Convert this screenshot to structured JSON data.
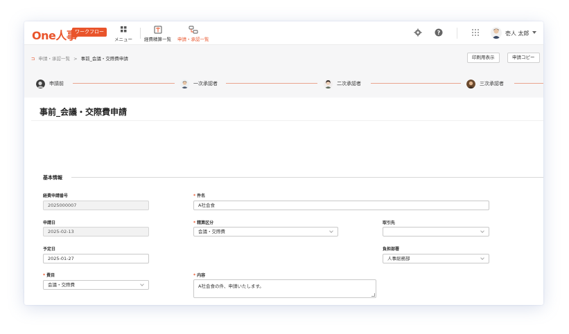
{
  "app": {
    "logo": "One人事",
    "logo_tag": "ワークフロー"
  },
  "nav": [
    {
      "label": "メニュー",
      "icon": "grid-menu-icon"
    },
    {
      "label": "経費精算一覧",
      "icon": "expense-list-icon"
    },
    {
      "label": "申請・承認一覧",
      "icon": "approval-list-icon",
      "active": true
    }
  ],
  "header": {
    "user_name": "壱人 太郎",
    "icons": [
      "settings-gear-icon",
      "help-icon",
      "apps-grid-icon"
    ]
  },
  "breadcrumb": {
    "items": [
      "申請・承認一覧",
      "事前_会議・交際費申請"
    ],
    "separator": ">"
  },
  "actions": {
    "print_label": "印刷用表示",
    "copy_label": "申請コピー"
  },
  "steps": [
    "申請前",
    "一次承認者",
    "二次承認者",
    "三次承認者"
  ],
  "page": {
    "title": "事前_会議・交際費申請",
    "section_title": "基本情報"
  },
  "form": {
    "expense_number": {
      "label": "経費申請番号",
      "value": "2025000007"
    },
    "subject": {
      "label": "件名",
      "value": "A社会食",
      "required": true
    },
    "apply_date": {
      "label": "申請日",
      "value": "2025-02-13"
    },
    "category": {
      "label": "精算区分",
      "value": "会議・交際費",
      "required": true
    },
    "partner": {
      "label": "取引先",
      "value": ""
    },
    "planned_date": {
      "label": "予定日",
      "value": "2025-01-27"
    },
    "department": {
      "label": "負担部署",
      "value": "人事総務部"
    },
    "account": {
      "label": "費目",
      "value": "会議・交際費",
      "required": true
    },
    "content": {
      "label": "内容",
      "value": "A社会食の件、申請いたします。",
      "required": true
    }
  },
  "colors": {
    "brand": "#e9542b",
    "step_line": "#e9a48e"
  }
}
